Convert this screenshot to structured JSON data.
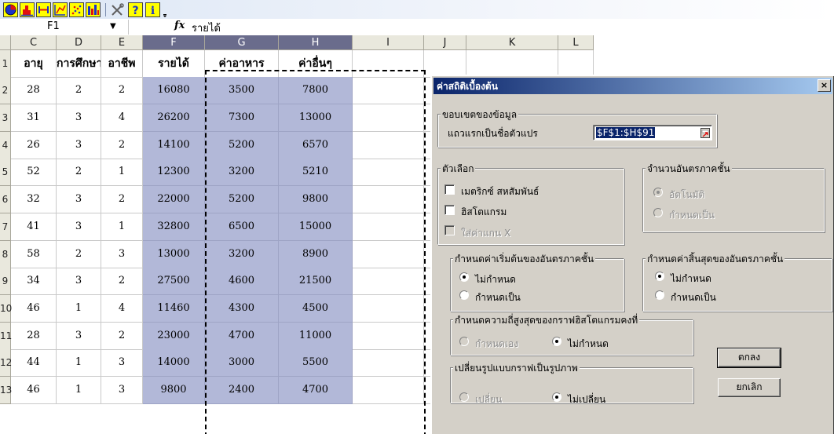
{
  "toolbar": {
    "icons": [
      "pie-chart-icon",
      "histogram-icon",
      "interval-icon",
      "scatter-icon",
      "scatter-pattern-icon",
      "bar-chart-icon",
      "tools-icon",
      "help-icon",
      "info-icon",
      "overflow-icon"
    ]
  },
  "formula_bar": {
    "name_box": "F1",
    "fx": "fx",
    "formula": "รายได้"
  },
  "columns": [
    "C",
    "D",
    "E",
    "F",
    "G",
    "H",
    "I",
    "J",
    "K",
    "L"
  ],
  "selected_columns": [
    "F",
    "G",
    "H"
  ],
  "rows": [
    {
      "num": "1",
      "cells": [
        "อายุ",
        "การศึกษา",
        "อาชีพ",
        "รายได้",
        "ค่าอาหาร",
        "ค่าอื่นๆ"
      ]
    },
    {
      "num": "2",
      "cells": [
        "28",
        "2",
        "2",
        "16080",
        "3500",
        "7800"
      ]
    },
    {
      "num": "3",
      "cells": [
        "31",
        "3",
        "4",
        "26200",
        "7300",
        "13000"
      ]
    },
    {
      "num": "4",
      "cells": [
        "26",
        "3",
        "2",
        "14100",
        "5200",
        "6570"
      ]
    },
    {
      "num": "5",
      "cells": [
        "52",
        "2",
        "1",
        "12300",
        "3200",
        "5210"
      ]
    },
    {
      "num": "6",
      "cells": [
        "32",
        "3",
        "2",
        "22000",
        "5200",
        "9800"
      ]
    },
    {
      "num": "7",
      "cells": [
        "41",
        "3",
        "1",
        "32800",
        "6500",
        "15000"
      ]
    },
    {
      "num": "8",
      "cells": [
        "58",
        "2",
        "3",
        "13000",
        "3200",
        "8900"
      ]
    },
    {
      "num": "9",
      "cells": [
        "34",
        "3",
        "2",
        "27500",
        "4600",
        "21500"
      ]
    },
    {
      "num": "10",
      "cells": [
        "46",
        "1",
        "4",
        "11460",
        "4300",
        "4500"
      ]
    },
    {
      "num": "11",
      "cells": [
        "28",
        "3",
        "2",
        "23000",
        "4700",
        "11000"
      ]
    },
    {
      "num": "12",
      "cells": [
        "44",
        "1",
        "3",
        "14000",
        "3000",
        "5500"
      ]
    },
    {
      "num": "13",
      "cells": [
        "46",
        "1",
        "3",
        "9800",
        "2400",
        "4700"
      ]
    }
  ],
  "dialog": {
    "title": "ค่าสถิติเบื้องต้น",
    "close": "×",
    "data_range": {
      "legend": "ขอบเขตของข้อมูล",
      "label": "แถวแรกเป็นชื่อตัวแปร",
      "value": "$F$1:$H$91"
    },
    "options": {
      "legend": "ตัวเลือก",
      "correlation_matrix": "เมตริกซ์ สหสัมพันธ์",
      "histogram": "ฮิสโตแกรม",
      "x_axis_value": "ใส่ค่าแกน X"
    },
    "num_classes": {
      "legend": "จำนวนอันตรภาคชั้น",
      "auto": "อัตโนมัติ",
      "specify": "กำหนดเป็น"
    },
    "class_start": {
      "legend": "กำหนดค่าเริ่มต้นของอันตรภาคชั้น",
      "none": "ไม่กำหนด",
      "specify": "กำหนดเป็น"
    },
    "class_end": {
      "legend": "กำหนดค่าสิ้นสุดของอันตรภาคชั้น",
      "none": "ไม่กำหนด",
      "specify": "กำหนดเป็น"
    },
    "max_freq": {
      "legend": "กำหนดความถี่สูงสุดของกราฟฮิสโตแกรมคงที่",
      "self": "กำหนดเอง",
      "none": "ไม่กำหนด"
    },
    "chart_type": {
      "legend": "เปลี่ยนรูปแบบกราฟเป็นรูปภาพ",
      "change": "เปลี่ยน",
      "no_change": "ไม่เปลี่ยน"
    },
    "ok": "ตกลง",
    "cancel": "ยกเลิก"
  }
}
